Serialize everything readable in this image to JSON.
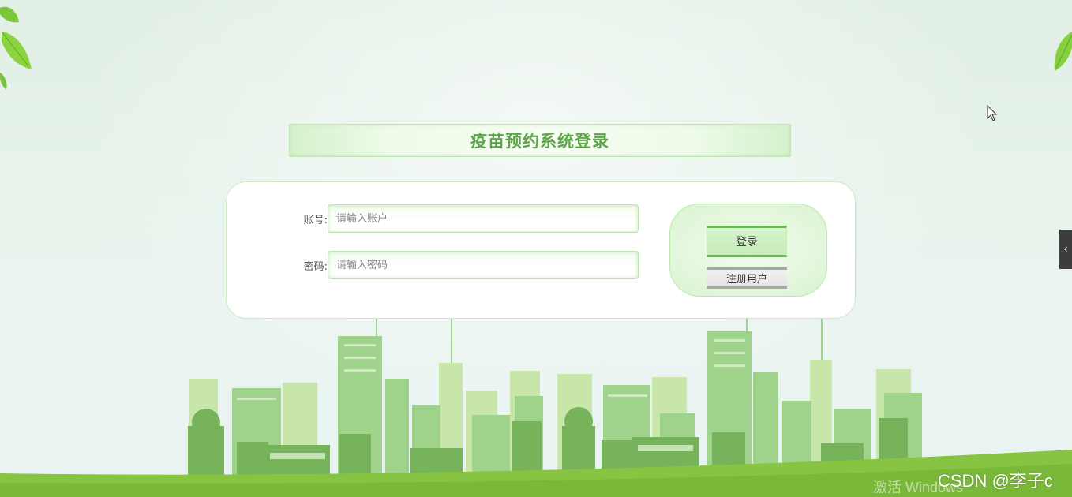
{
  "page": {
    "title": "疫苗预约系统登录"
  },
  "form": {
    "account": {
      "label": "账号:",
      "placeholder": "请输入账户",
      "value": ""
    },
    "password": {
      "label": "密码:",
      "placeholder": "请输入密码",
      "value": ""
    }
  },
  "actions": {
    "login_label": "登录",
    "register_label": "注册用户"
  },
  "side_tab": {
    "glyph": "‹"
  },
  "watermarks": {
    "csdn": "CSDN @李子c",
    "windows": "激活 Windows"
  },
  "colors": {
    "accent_green": "#67b754",
    "title_green": "#5ea44a",
    "panel_border": "#cdeac4"
  },
  "icons": [
    "leaf-icon",
    "cursor-icon",
    "collapse-arrow-icon"
  ]
}
